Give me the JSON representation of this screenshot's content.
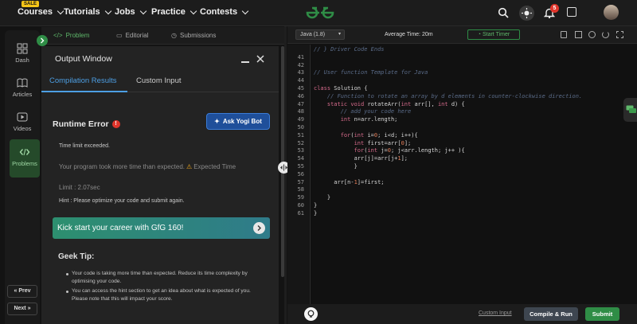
{
  "nav": {
    "sale_badge": "SALE",
    "items": [
      {
        "label": "Courses"
      },
      {
        "label": "Tutorials"
      },
      {
        "label": "Jobs"
      },
      {
        "label": "Practice"
      },
      {
        "label": "Contests"
      }
    ],
    "notification_count": "5",
    "logo_color": "#2f8d46"
  },
  "rail": {
    "items": [
      {
        "label": "Dash",
        "icon": "dashboard-icon"
      },
      {
        "label": "Articles",
        "icon": "book-icon"
      },
      {
        "label": "Videos",
        "icon": "play-icon"
      },
      {
        "label": "Problems",
        "icon": "code-icon"
      }
    ],
    "prev_label": "Prev",
    "next_label": "Next"
  },
  "problem_tabs": [
    {
      "label": "Problem"
    },
    {
      "label": "Editorial"
    },
    {
      "label": "Submissions"
    }
  ],
  "output": {
    "title": "Output Window",
    "tabs": [
      {
        "label": "Compilation Results"
      },
      {
        "label": "Custom Input"
      }
    ],
    "error_title": "Runtime Error",
    "ask_bot_label": "Ask Yogi Bot",
    "status_line": "Time limit exceeded.",
    "message": "Your program took more time than expected.",
    "message_suffix": "Expected Time",
    "limit": "Limit : 2.07sec",
    "hint": "Hint : Please optimize your code and submit again.",
    "promo": "Kick start your career with GfG 160!",
    "tip_title": "Geek Tip:",
    "tips": [
      "Your code is taking more time than expected. Reduce its time complexity by optimising your code.",
      "You can access the hint section to get an idea about what is expected of you. Please note that this will impact your score."
    ]
  },
  "editor": {
    "language": "Java (1.8)",
    "average_time": "Average Time: 20m",
    "timer_label": "Start Timer",
    "lines": [
      {
        "n": "",
        "text": "// } Driver Code Ends"
      },
      {
        "n": "41",
        "text": ""
      },
      {
        "n": "42",
        "text": ""
      },
      {
        "n": "43",
        "text": "// User function Template for Java"
      },
      {
        "n": "44",
        "text": ""
      },
      {
        "n": "45",
        "text": "class Solution {"
      },
      {
        "n": "46",
        "text": "    // Function to rotate an array by d elements in counter-clockwise direction."
      },
      {
        "n": "47",
        "text": "    static void rotateArr(int arr[], int d) {"
      },
      {
        "n": "48",
        "text": "        // add your code here"
      },
      {
        "n": "49",
        "text": "        int n=arr.length;"
      },
      {
        "n": "50",
        "text": ""
      },
      {
        "n": "51",
        "text": "        for(int i=0; i<d; i++){"
      },
      {
        "n": "52",
        "text": "            int first=arr[0];"
      },
      {
        "n": "53",
        "text": "            for(int j=0; j<arr.length; j++ ){"
      },
      {
        "n": "54",
        "text": "            arr[j]=arr[j+1];"
      },
      {
        "n": "55",
        "text": "            }"
      },
      {
        "n": "56",
        "text": ""
      },
      {
        "n": "57",
        "text": "      arr[n-1]=first;"
      },
      {
        "n": "58",
        "text": ""
      },
      {
        "n": "59",
        "text": "    }"
      },
      {
        "n": "60",
        "text": "}"
      },
      {
        "n": "61",
        "text": "}"
      }
    ],
    "custom_input_label": "Custom Input",
    "compile_label": "Compile & Run",
    "submit_label": "Submit"
  }
}
